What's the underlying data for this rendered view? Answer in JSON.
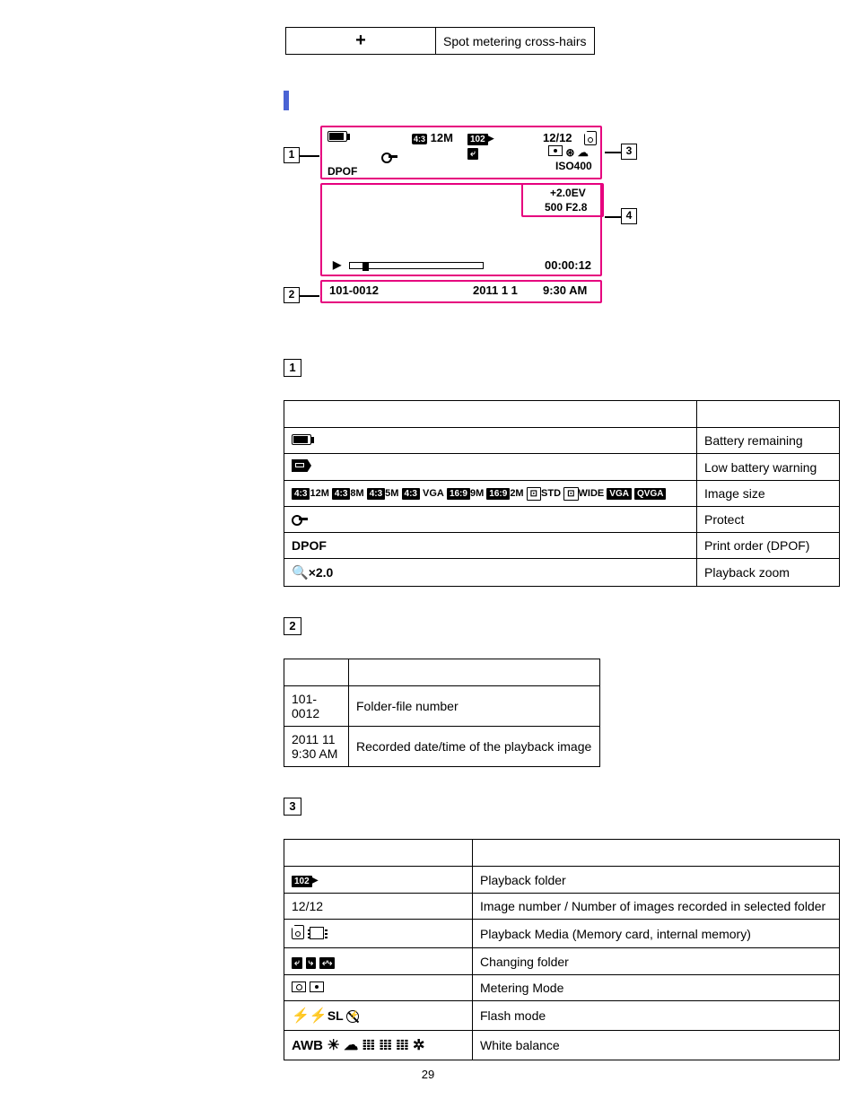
{
  "topRow": {
    "desc": "Spot metering cross-hairs"
  },
  "diagram": {
    "ratio": "4:3",
    "size": "12M",
    "folder": "102",
    "count": "12/12",
    "iso": "ISO400",
    "dpof": "DPOF",
    "ev": "+2.0EV",
    "shutter": "500 F2.8",
    "time": "00:00:12",
    "file": "101-0012",
    "date": "2011 1 1",
    "clock": "9:30 AM"
  },
  "sec1": {
    "r1": "Battery remaining",
    "r2": "Low battery warning",
    "r3_icons": "12M 8M 5M VGA 9M 2M STD WIDE",
    "r3": "Image size",
    "r4": "Protect",
    "r5_label": "DPOF",
    "r5": "Print order (DPOF)",
    "r6_label": "×2.0",
    "r6": "Playback zoom"
  },
  "sec2": {
    "r1_v": "101-0012",
    "r1": "Folder-file number",
    "r2_v": "2011 11 9:30 AM",
    "r2": "Recorded date/time of the playback image"
  },
  "sec3": {
    "r1": "Playback folder",
    "r2_v": "12/12",
    "r2": "Image number / Number of images recorded in selected folder",
    "r3": "Playback Media (Memory card, internal memory)",
    "r4": "Changing folder",
    "r5": "Metering Mode",
    "r6_label": "SL",
    "r6": "Flash mode",
    "r7_label": "AWB",
    "r7": "White balance"
  },
  "pageNum": "29"
}
